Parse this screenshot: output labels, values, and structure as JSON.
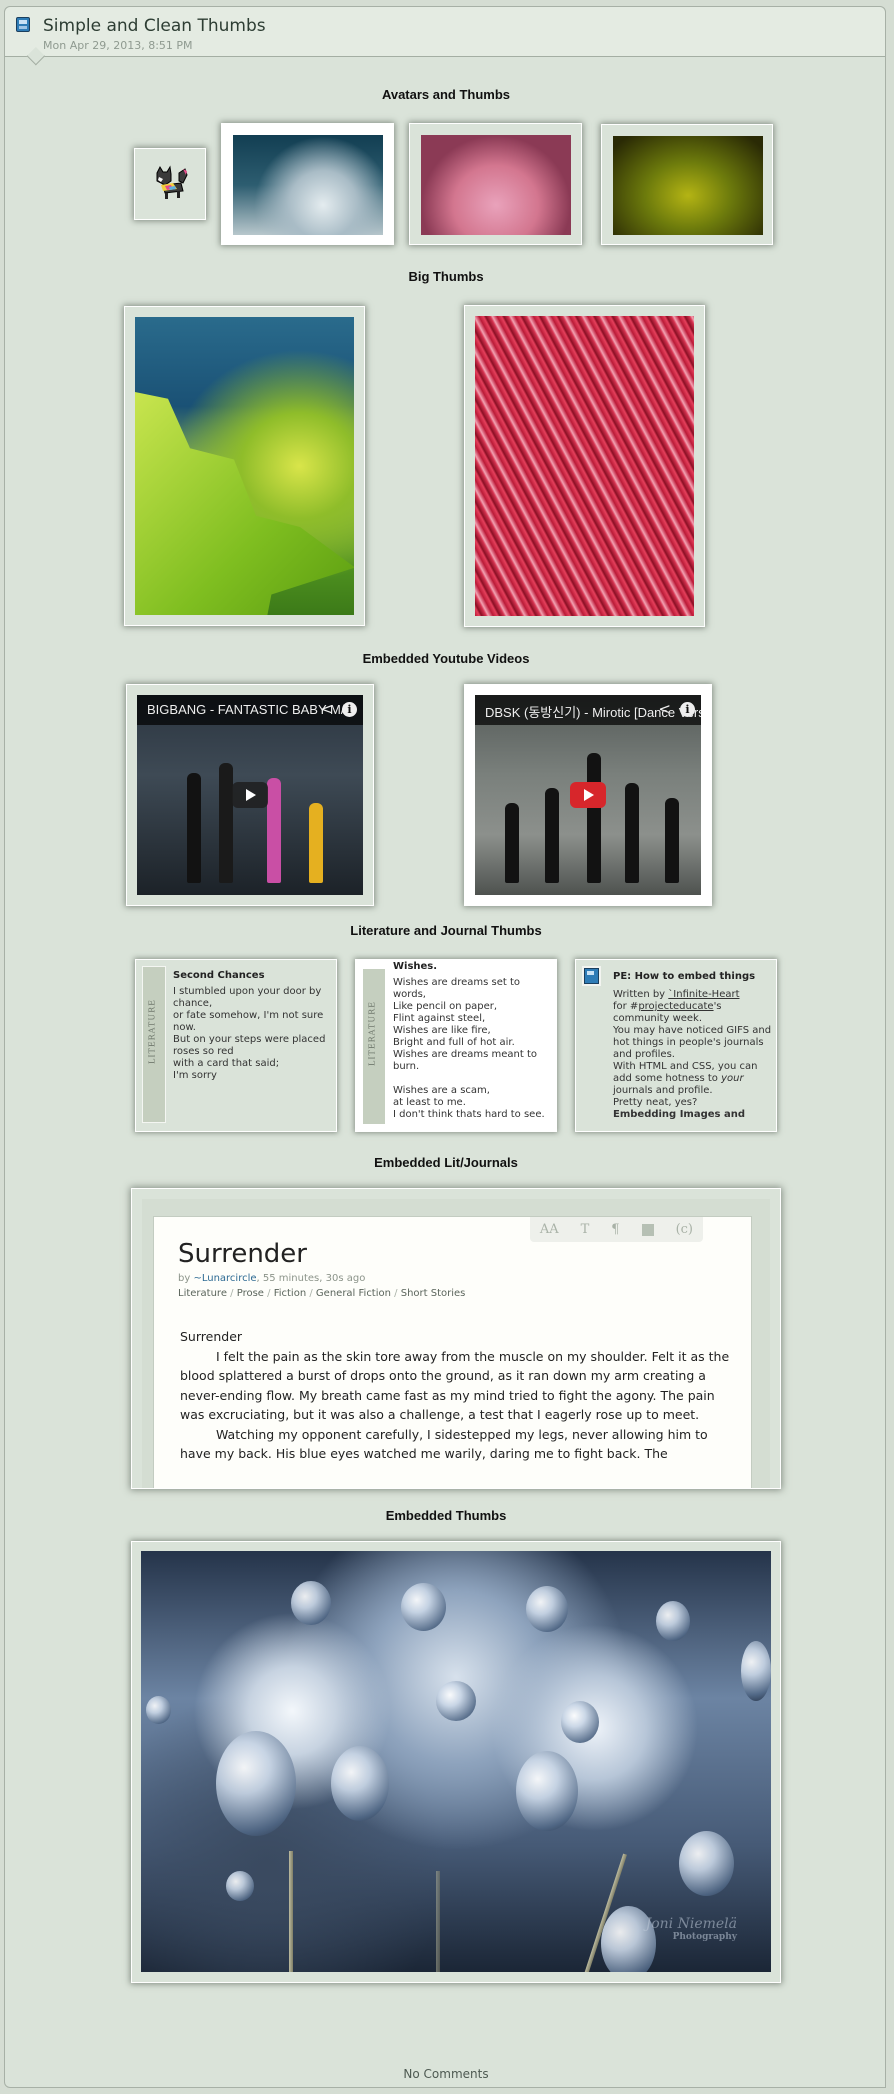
{
  "header": {
    "icon": "journal-icon",
    "title": "Simple and Clean Thumbs",
    "date": "Mon Apr 29, 2013, 8:51 PM"
  },
  "sections": {
    "avatars_thumbs": "Avatars and Thumbs",
    "big_thumbs": "Big Thumbs",
    "youtube": "Embedded Youtube Videos",
    "lit_journal": "Literature and Journal Thumbs",
    "embedded_lit": "Embedded Lit/Journals",
    "embedded_thumbs": "Embedded Thumbs"
  },
  "videos": [
    {
      "title": "BIGBANG - FANTASTIC BABY M/V",
      "share_icon": "share-icon",
      "info_icon": "info-icon",
      "play_style": "dark"
    },
    {
      "title": "DBSK (동방신기) - Mirotic [Dance Version]",
      "share_icon": "share-icon",
      "info_icon": "info-icon",
      "play_style": "red"
    }
  ],
  "lit_thumbs": [
    {
      "spine_label": "LITERATURE",
      "title": "Second Chances",
      "body": "I stumbled upon your door by chance,\nor fate somehow, I'm not sure now.\nBut on your steps were placed roses so red\nwith a card that said;\nI'm sorry"
    },
    {
      "spine_label": "LITERATURE",
      "title": "Wishes.",
      "body": "Wishes are dreams set to words,\nLike pencil on paper,\nFlint against steel,\nWishes are like fire,\nBright and full of hot air.\nWishes are dreams meant to burn.\n\nWishes are a scam,\nat least to me.\nI don't think thats hard to see."
    },
    {
      "icon": "journal-icon",
      "title": "PE: How to embed things",
      "written_by": "Written by ",
      "author": "`Infinite-Heart",
      "for_text": "for #",
      "group": "projecteducate",
      "after_group": "'s community week.",
      "body": "You may have noticed GIFS and hot things in people's journals and profiles.\nWith HTML and CSS, you can add some hotness to ",
      "em": "your",
      "body_end": " journals and profile.\nPretty neat, yes?",
      "bold_tail": "Embedding Images and"
    }
  ],
  "embedded_lit": {
    "toolbar": [
      "AA",
      "T",
      "¶",
      "■",
      "(c)"
    ],
    "title": "Surrender",
    "by_prefix": "by ",
    "author": "~Lunarcircle",
    "time": ", 55 minutes, 30s ago",
    "categories": [
      "Literature",
      "Prose",
      "Fiction",
      "General Fiction",
      "Short Stories"
    ],
    "heading": "Surrender",
    "paragraphs": [
      "I felt the pain as the skin tore away from the muscle on my shoulder.  Felt it as the blood splattered a burst of drops onto the ground, as it ran down my arm creating a never-ending flow.  My breath came fast as my mind tried to fight the agony.  The pain was excruciating, but it was also a challenge, a test that I eagerly rose up to meet.",
      "Watching my opponent carefully, I sidestepped my legs, never allowing him to have my back.  His blue eyes watched me warily, daring me to fight back.  The"
    ]
  },
  "embedded_thumb": {
    "watermark": "Joni Niemelä",
    "watermark_sub": "Photography"
  },
  "footer": {
    "comments": "No Comments"
  }
}
